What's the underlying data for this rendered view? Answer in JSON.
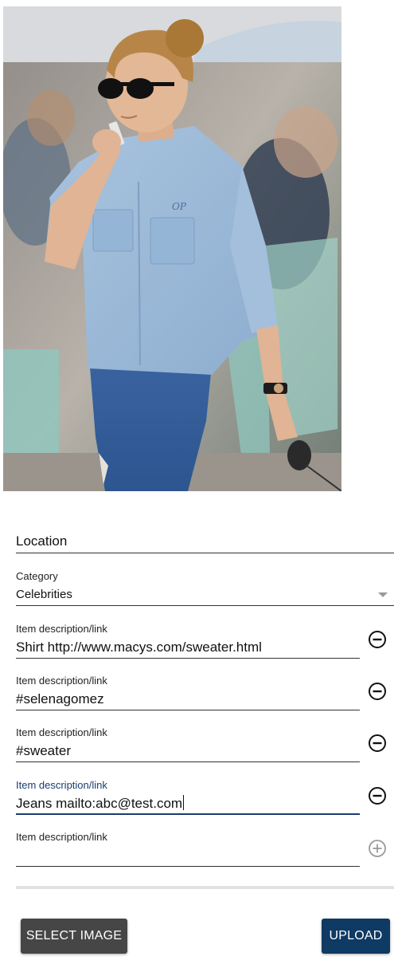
{
  "photo": {
    "alt": "",
    "pocket_monogram": "OP"
  },
  "form": {
    "location": {
      "placeholder": "Location",
      "value": ""
    },
    "category": {
      "label": "Category",
      "selected": "Celebrities"
    },
    "items": [
      {
        "label": "Item description/link",
        "value": "Shirt http://www.macys.com/sweater.html",
        "action_icon": "remove-circle-icon"
      },
      {
        "label": "Item description/link",
        "value": "#selenagomez",
        "action_icon": "remove-circle-icon"
      },
      {
        "label": "Item description/link",
        "value": "#sweater",
        "action_icon": "remove-circle-icon"
      },
      {
        "label": "Item description/link",
        "value": "Jeans mailto:abc@test.com",
        "action_icon": "remove-circle-icon",
        "focused": true
      },
      {
        "label": "Item description/link",
        "value": "",
        "action_icon": "add-circle-icon"
      }
    ]
  },
  "buttons": {
    "select_image": "SELECT IMAGE",
    "upload": "UPLOAD"
  },
  "colors": {
    "focus": "#1a3c70",
    "upload_bg": "#0e3a63",
    "select_bg": "#464646",
    "add_icon": "#9a9a9a"
  }
}
